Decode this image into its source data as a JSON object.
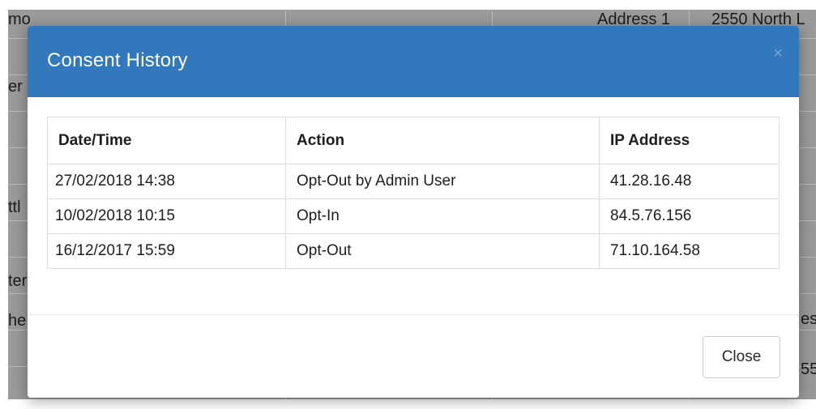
{
  "background": {
    "texts": {
      "top_left": "mo",
      "address_label": "Address 1",
      "address_value": "2550 North L",
      "row_er": "er",
      "row_ttl": "ttl",
      "row_ter": "ter",
      "row_he": "he",
      "right_es": "es",
      "right_55": "55"
    }
  },
  "modal": {
    "title": "Consent History",
    "close_icon": "×",
    "table": {
      "headers": [
        "Date/Time",
        "Action",
        "IP Address"
      ],
      "rows": [
        [
          "27/02/2018 14:38",
          "Opt-Out by Admin User",
          "41.28.16.48"
        ],
        [
          "10/02/2018 10:15",
          "Opt-In",
          "84.5.76.156"
        ],
        [
          "16/12/2017 15:59",
          "Opt-Out",
          "71.10.164.58"
        ]
      ]
    },
    "footer": {
      "close_label": "Close"
    }
  },
  "colors": {
    "header_bg": "#3278bd",
    "overlay_bg": "#9a9a9a"
  }
}
